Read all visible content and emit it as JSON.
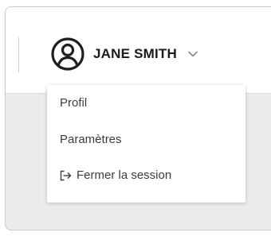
{
  "header": {
    "user": {
      "avatar_icon": "user-circle-icon",
      "name": "JANE SMITH",
      "dropdown_icon": "chevron-down-icon"
    }
  },
  "user_menu": {
    "items": [
      {
        "label": "Profil"
      },
      {
        "label": "Paramètres"
      },
      {
        "label": "Fermer la session",
        "icon": "logout-icon"
      }
    ]
  }
}
